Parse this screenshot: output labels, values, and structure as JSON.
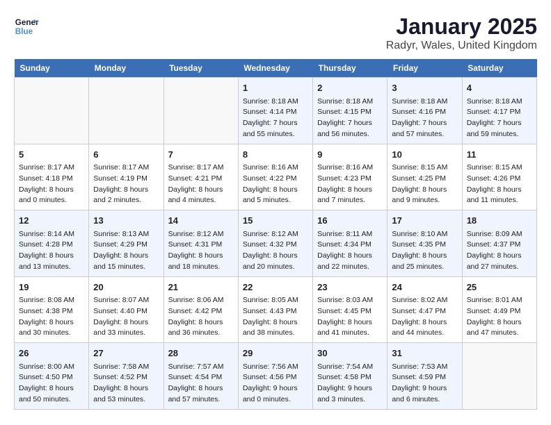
{
  "header": {
    "logo_line1": "General",
    "logo_line2": "Blue",
    "title": "January 2025",
    "subtitle": "Radyr, Wales, United Kingdom"
  },
  "days_of_week": [
    "Sunday",
    "Monday",
    "Tuesday",
    "Wednesday",
    "Thursday",
    "Friday",
    "Saturday"
  ],
  "weeks": [
    [
      {
        "day": "",
        "content": ""
      },
      {
        "day": "",
        "content": ""
      },
      {
        "day": "",
        "content": ""
      },
      {
        "day": "1",
        "content": "Sunrise: 8:18 AM\nSunset: 4:14 PM\nDaylight: 7 hours\nand 55 minutes."
      },
      {
        "day": "2",
        "content": "Sunrise: 8:18 AM\nSunset: 4:15 PM\nDaylight: 7 hours\nand 56 minutes."
      },
      {
        "day": "3",
        "content": "Sunrise: 8:18 AM\nSunset: 4:16 PM\nDaylight: 7 hours\nand 57 minutes."
      },
      {
        "day": "4",
        "content": "Sunrise: 8:18 AM\nSunset: 4:17 PM\nDaylight: 7 hours\nand 59 minutes."
      }
    ],
    [
      {
        "day": "5",
        "content": "Sunrise: 8:17 AM\nSunset: 4:18 PM\nDaylight: 8 hours\nand 0 minutes."
      },
      {
        "day": "6",
        "content": "Sunrise: 8:17 AM\nSunset: 4:19 PM\nDaylight: 8 hours\nand 2 minutes."
      },
      {
        "day": "7",
        "content": "Sunrise: 8:17 AM\nSunset: 4:21 PM\nDaylight: 8 hours\nand 4 minutes."
      },
      {
        "day": "8",
        "content": "Sunrise: 8:16 AM\nSunset: 4:22 PM\nDaylight: 8 hours\nand 5 minutes."
      },
      {
        "day": "9",
        "content": "Sunrise: 8:16 AM\nSunset: 4:23 PM\nDaylight: 8 hours\nand 7 minutes."
      },
      {
        "day": "10",
        "content": "Sunrise: 8:15 AM\nSunset: 4:25 PM\nDaylight: 8 hours\nand 9 minutes."
      },
      {
        "day": "11",
        "content": "Sunrise: 8:15 AM\nSunset: 4:26 PM\nDaylight: 8 hours\nand 11 minutes."
      }
    ],
    [
      {
        "day": "12",
        "content": "Sunrise: 8:14 AM\nSunset: 4:28 PM\nDaylight: 8 hours\nand 13 minutes."
      },
      {
        "day": "13",
        "content": "Sunrise: 8:13 AM\nSunset: 4:29 PM\nDaylight: 8 hours\nand 15 minutes."
      },
      {
        "day": "14",
        "content": "Sunrise: 8:12 AM\nSunset: 4:31 PM\nDaylight: 8 hours\nand 18 minutes."
      },
      {
        "day": "15",
        "content": "Sunrise: 8:12 AM\nSunset: 4:32 PM\nDaylight: 8 hours\nand 20 minutes."
      },
      {
        "day": "16",
        "content": "Sunrise: 8:11 AM\nSunset: 4:34 PM\nDaylight: 8 hours\nand 22 minutes."
      },
      {
        "day": "17",
        "content": "Sunrise: 8:10 AM\nSunset: 4:35 PM\nDaylight: 8 hours\nand 25 minutes."
      },
      {
        "day": "18",
        "content": "Sunrise: 8:09 AM\nSunset: 4:37 PM\nDaylight: 8 hours\nand 27 minutes."
      }
    ],
    [
      {
        "day": "19",
        "content": "Sunrise: 8:08 AM\nSunset: 4:38 PM\nDaylight: 8 hours\nand 30 minutes."
      },
      {
        "day": "20",
        "content": "Sunrise: 8:07 AM\nSunset: 4:40 PM\nDaylight: 8 hours\nand 33 minutes."
      },
      {
        "day": "21",
        "content": "Sunrise: 8:06 AM\nSunset: 4:42 PM\nDaylight: 8 hours\nand 36 minutes."
      },
      {
        "day": "22",
        "content": "Sunrise: 8:05 AM\nSunset: 4:43 PM\nDaylight: 8 hours\nand 38 minutes."
      },
      {
        "day": "23",
        "content": "Sunrise: 8:03 AM\nSunset: 4:45 PM\nDaylight: 8 hours\nand 41 minutes."
      },
      {
        "day": "24",
        "content": "Sunrise: 8:02 AM\nSunset: 4:47 PM\nDaylight: 8 hours\nand 44 minutes."
      },
      {
        "day": "25",
        "content": "Sunrise: 8:01 AM\nSunset: 4:49 PM\nDaylight: 8 hours\nand 47 minutes."
      }
    ],
    [
      {
        "day": "26",
        "content": "Sunrise: 8:00 AM\nSunset: 4:50 PM\nDaylight: 8 hours\nand 50 minutes."
      },
      {
        "day": "27",
        "content": "Sunrise: 7:58 AM\nSunset: 4:52 PM\nDaylight: 8 hours\nand 53 minutes."
      },
      {
        "day": "28",
        "content": "Sunrise: 7:57 AM\nSunset: 4:54 PM\nDaylight: 8 hours\nand 57 minutes."
      },
      {
        "day": "29",
        "content": "Sunrise: 7:56 AM\nSunset: 4:56 PM\nDaylight: 9 hours\nand 0 minutes."
      },
      {
        "day": "30",
        "content": "Sunrise: 7:54 AM\nSunset: 4:58 PM\nDaylight: 9 hours\nand 3 minutes."
      },
      {
        "day": "31",
        "content": "Sunrise: 7:53 AM\nSunset: 4:59 PM\nDaylight: 9 hours\nand 6 minutes."
      },
      {
        "day": "",
        "content": ""
      }
    ]
  ]
}
